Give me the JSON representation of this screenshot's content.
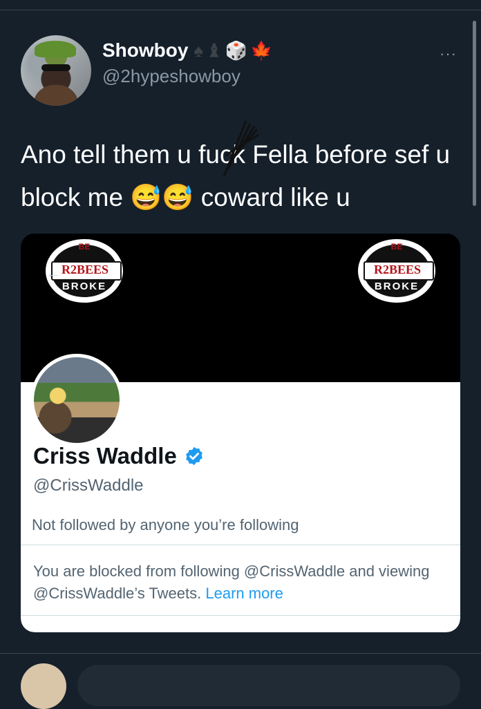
{
  "tweet": {
    "display_name": "Showboy",
    "name_emojis": [
      "♠",
      "♝",
      "🎲",
      "🍁"
    ],
    "handle": "@2hypeshowboy",
    "more_label": "···",
    "text": "Ano tell them u fuck Fella before sef u block me 😅😅 coward like u"
  },
  "card": {
    "banner_logo_text": "R2BEES",
    "banner_logo_subtext": "BROKE",
    "banner_logo_top": "BE",
    "profile_name": "Criss Waddle",
    "profile_handle": "@CrissWaddle",
    "not_followed_text": "Not followed by anyone you’re following",
    "blocked_text": "You are blocked from following @CrissWaddle and viewing @CrissWaddle’s Tweets.",
    "learn_more": "Learn more"
  },
  "colors": {
    "background": "#15202b",
    "link": "#1d9bf0",
    "verified": "#1d9bf0"
  }
}
